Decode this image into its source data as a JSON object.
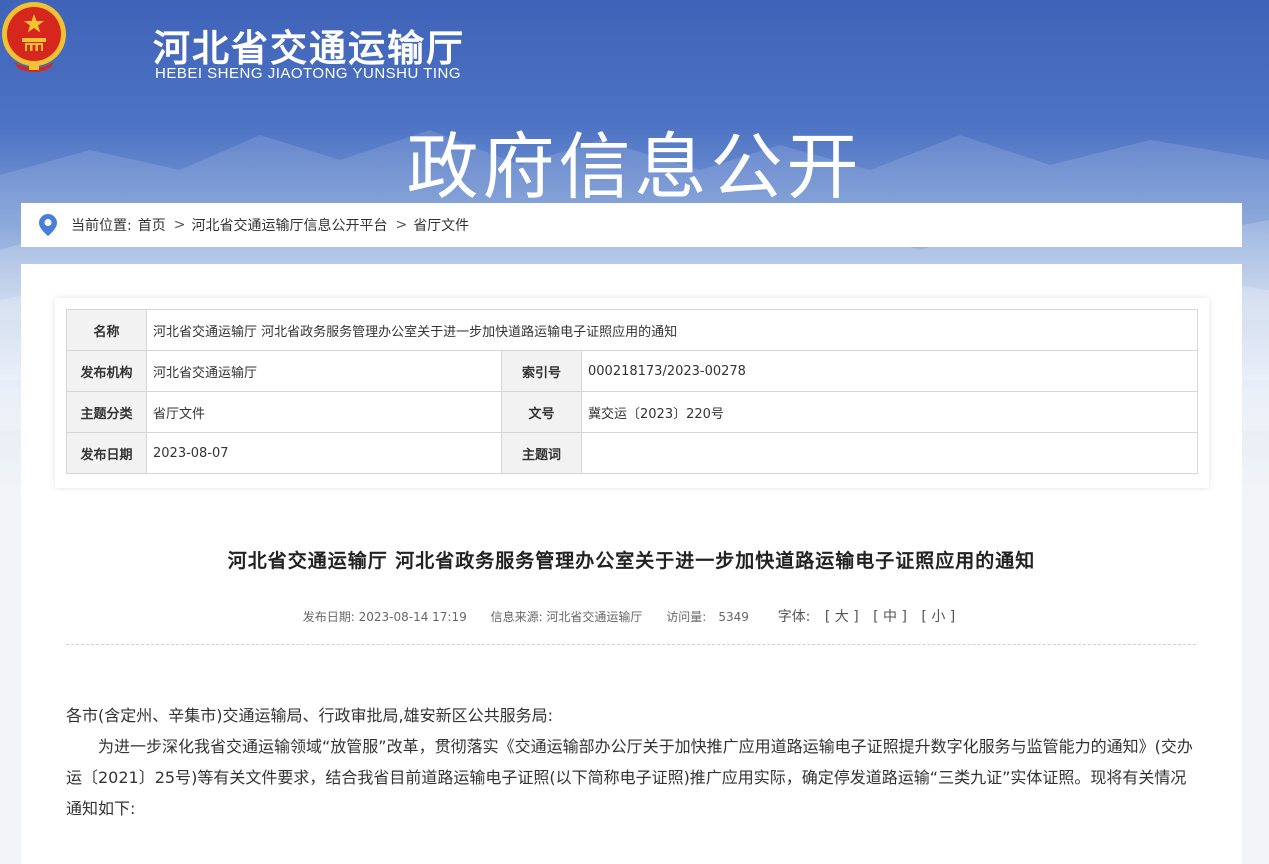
{
  "header": {
    "site_name_cn": "河北省交通运输厅",
    "site_name_en": "HEBEI SHENG JIAOTONG YUNSHU TING",
    "banner_title": "政府信息公开"
  },
  "breadcrumb": {
    "prefix": "当前位置:",
    "items": [
      "首页",
      "河北省交通运输厅信息公开平台",
      "省厅文件"
    ],
    "separator": ">"
  },
  "meta": {
    "name_label": "名称",
    "name_value": "河北省交通运输厅 河北省政务服务管理办公室关于进一步加快道路运输电子证照应用的通知",
    "publisher_label": "发布机构",
    "publisher_value": "河北省交通运输厅",
    "index_label": "索引号",
    "index_value": "000218173/2023-00278",
    "category_label": "主题分类",
    "category_value": "省厅文件",
    "docno_label": "文号",
    "docno_value": "冀交运〔2023〕220号",
    "date_label": "发布日期",
    "date_value": "2023-08-07",
    "keywords_label": "主题词",
    "keywords_value": ""
  },
  "article": {
    "title": "河北省交通运输厅 河北省政务服务管理办公室关于进一步加快道路运输电子证照应用的通知",
    "publish_time": "发布日期: 2023-08-14 17:19",
    "source": "信息来源: 河北省交通运输厅",
    "views_label": "访问量:",
    "views_value": "5349",
    "font_label": "字体:",
    "font_large": "[ 大 ]",
    "font_medium": "[ 中 ]",
    "font_small": "[ 小 ]",
    "para1": "各市(含定州、辛集市)交通运输局、行政审批局,雄安新区公共服务局:",
    "para2": "为进一步深化我省交通运输领域“放管服”改革，贯彻落实《交通运输部办公厅关于加快推广应用道路运输电子证照提升数字化服务与监管能力的通知》(交办运〔2021〕25号)等有关文件要求，结合我省目前道路运输电子证照(以下简称电子证照)推广应用实际，确定停发道路运输“三类九证”实体证照。现将有关情况通知如下:"
  },
  "colors": {
    "banner_blue": "#3f63b8",
    "emblem_red": "#d7261d",
    "emblem_gold": "#f2c230",
    "pin_blue": "#4a7fd8"
  }
}
